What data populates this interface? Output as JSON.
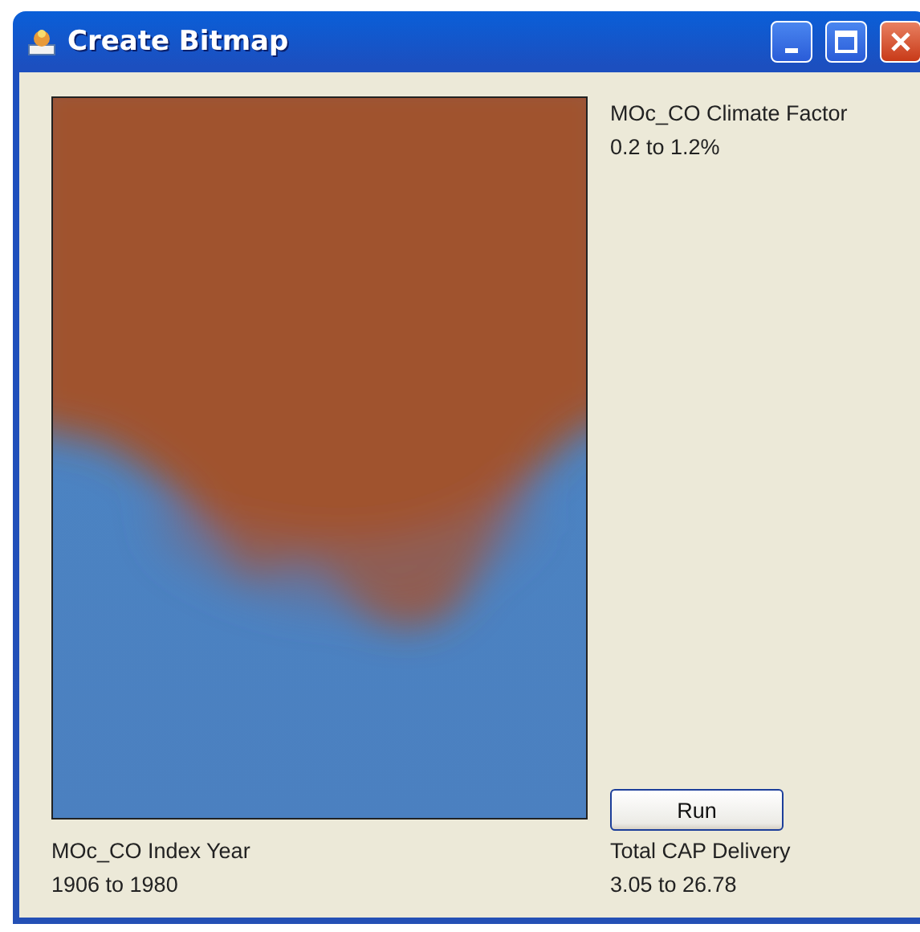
{
  "window": {
    "title": "Create Bitmap"
  },
  "axis_labels": {
    "top_right": {
      "name": "MOc_CO Climate Factor",
      "range": "0.2 to 1.2%"
    },
    "bottom_left": {
      "name": "MOc_CO Index Year",
      "range": "1906 to 1980"
    },
    "bottom_right": {
      "name": "Total CAP Delivery",
      "range": "3.05 to 26.78"
    }
  },
  "buttons": [
    {
      "label": "Run"
    }
  ]
}
